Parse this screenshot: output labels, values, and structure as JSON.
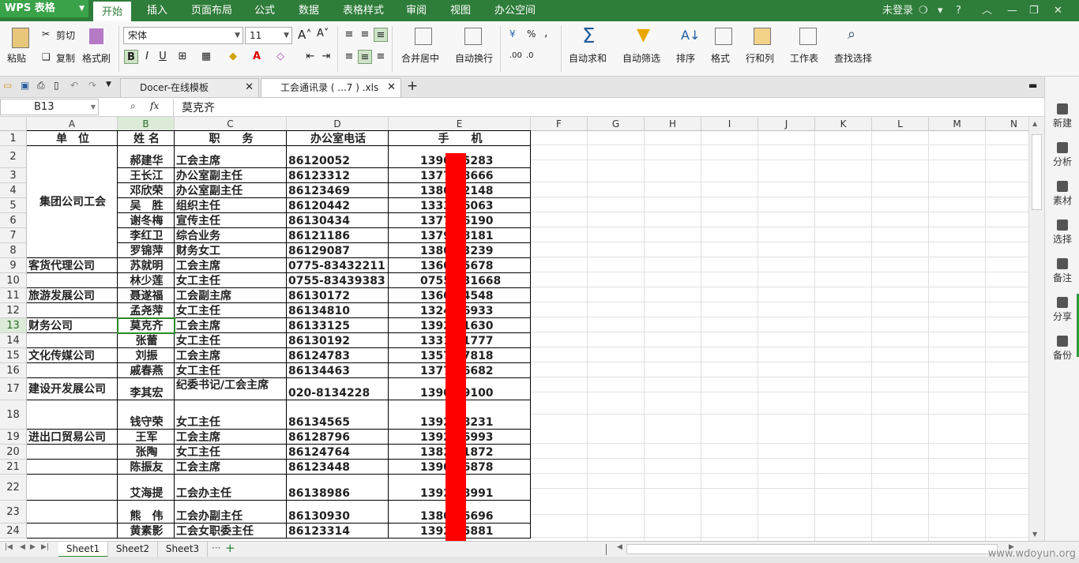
{
  "app": {
    "logo": "WPS 表格"
  },
  "menu": {
    "tabs": [
      "开始",
      "插入",
      "页面布局",
      "公式",
      "数据",
      "表格样式",
      "审阅",
      "视图",
      "办公空间"
    ],
    "login": "未登录",
    "help": "?"
  },
  "ribbon": {
    "paste": "粘贴",
    "cut": "剪切",
    "copy": "复制",
    "format_painter": "格式刷",
    "font_name": "宋体",
    "font_size": "11",
    "bold": "B",
    "italic": "I",
    "underline": "U",
    "merge_center": "合并居中",
    "wrap": "自动换行",
    "auto_sum": "自动求和",
    "auto_filter": "自动筛选",
    "sort": "排序",
    "format": "格式",
    "row_col": "行和列",
    "worksheet": "工作表",
    "find_select": "查找选择",
    "percent": "%",
    "comma": ","
  },
  "doc_tabs": [
    {
      "label": "Docer-在线模板"
    },
    {
      "label": "工会通讯录 ( ...7 ) .xls"
    }
  ],
  "formula_bar": {
    "name_box": "B13",
    "fx": "fx",
    "value": "莫克齐"
  },
  "columns": [
    "A",
    "B",
    "C",
    "D",
    "E",
    "F",
    "G",
    "H",
    "I",
    "J",
    "K",
    "L",
    "M",
    "N"
  ],
  "rows": [
    {
      "n": "1",
      "a": "单　位",
      "b": "姓 名",
      "c": "职　　务",
      "d": "办公室电话",
      "e": "手　　机"
    },
    {
      "n": "2",
      "a": "",
      "b": "郝建华",
      "c": "工会主席",
      "d": "86120052",
      "e": "1390  05283"
    },
    {
      "n": "3",
      "a": "",
      "b": "王长江",
      "c": "办公室副主任",
      "d": "86123312",
      "e": "1377  08666"
    },
    {
      "n": "4",
      "a": "",
      "b": "邓欣荣",
      "c": "办公室副主任",
      "d": "86123469",
      "e": "1380  52148"
    },
    {
      "n": "5",
      "a": "",
      "b": "吴　胜",
      "c": "组织主任",
      "d": "86120442",
      "e": "1333  86063"
    },
    {
      "n": "6",
      "a": "",
      "b": "谢冬梅",
      "c": "宣传主任",
      "d": "86130434",
      "e": "1377  56190"
    },
    {
      "n": "7",
      "a": "",
      "b": "李红卫",
      "c": "综合业务",
      "d": "86121186",
      "e": "1379  28181"
    },
    {
      "n": "8",
      "a": "",
      "b": "罗锦萍",
      "c": "财务女工",
      "d": "86129087",
      "e": "1380  73239"
    },
    {
      "n": "9",
      "a": "客货代理公司",
      "b": "苏就明",
      "c": "工会主席",
      "d": "0775-83432211",
      "e": "1360  25678"
    },
    {
      "n": "10",
      "a": "",
      "b": "林少莲",
      "c": "女工主任",
      "d": "0755-83439383",
      "e": "0755  331668"
    },
    {
      "n": "11",
      "a": "旅游发展公司",
      "b": "聂遂福",
      "c": "工会副主席",
      "d": "86130172",
      "e": "1360  64548"
    },
    {
      "n": "12",
      "a": "",
      "b": "孟尧萍",
      "c": "女工主任",
      "d": "86134810",
      "e": "1324  36933"
    },
    {
      "n": "13",
      "a": "财务公司",
      "b": "莫克齐",
      "c": "工会主席",
      "d": "86133125",
      "e": "1392  01630"
    },
    {
      "n": "14",
      "a": "",
      "b": "张蕾",
      "c": "女工主任",
      "d": "86130192",
      "e": "1331  41777"
    },
    {
      "n": "15",
      "a": "文化传媒公司",
      "b": "刘振",
      "c": "工会主席",
      "d": "86124783",
      "e": "1357  67818"
    },
    {
      "n": "16",
      "a": "",
      "b": "戚春燕",
      "c": "女工主任",
      "d": "86134463",
      "e": "1377  26682"
    },
    {
      "n": "17",
      "a": "建设开发展公司",
      "b": "李其宏",
      "c": "纪委书记/工会主席",
      "d": "020-8134228",
      "e": "1390  69100"
    },
    {
      "n": "18",
      "a": "",
      "b": "钱守荣",
      "c": "女工主任",
      "d": "86134565",
      "e": "1392  38231"
    },
    {
      "n": "19",
      "a": "进出口贸易公司",
      "b": "王军",
      "c": "工会主席",
      "d": "86128796",
      "e": "1392  36993"
    },
    {
      "n": "20",
      "a": "",
      "b": "张陶",
      "c": "女工主任",
      "d": "86124764",
      "e": "1382  11872"
    },
    {
      "n": "21",
      "a": "",
      "b": "陈振友",
      "c": "工会主席",
      "d": "86123448",
      "e": "1390  56878"
    },
    {
      "n": "22",
      "a": "",
      "b": "艾海提",
      "c": "工会办主任",
      "d": "86138986",
      "e": "1392  28991"
    },
    {
      "n": "23",
      "a": "",
      "b": "熊　伟",
      "c": "工会办副主任",
      "d": "86130930",
      "e": "1380  26696"
    },
    {
      "n": "24",
      "a": "",
      "b": "黄素影",
      "c": "工会女职委主任",
      "d": "86123314",
      "e": "1392  25881"
    }
  ],
  "merged_a": {
    "label": "集团公司工会"
  },
  "sidebar": [
    "新建",
    "分析",
    "素材",
    "选择",
    "备注",
    "分享",
    "备份"
  ],
  "sheets": [
    "Sheet1",
    "Sheet2",
    "Sheet3"
  ],
  "watermark": "www.wdoyun.org",
  "colors": {
    "accent": "#2f7d3a",
    "redact": "#ff0000",
    "selection": "#2a8a2a"
  }
}
